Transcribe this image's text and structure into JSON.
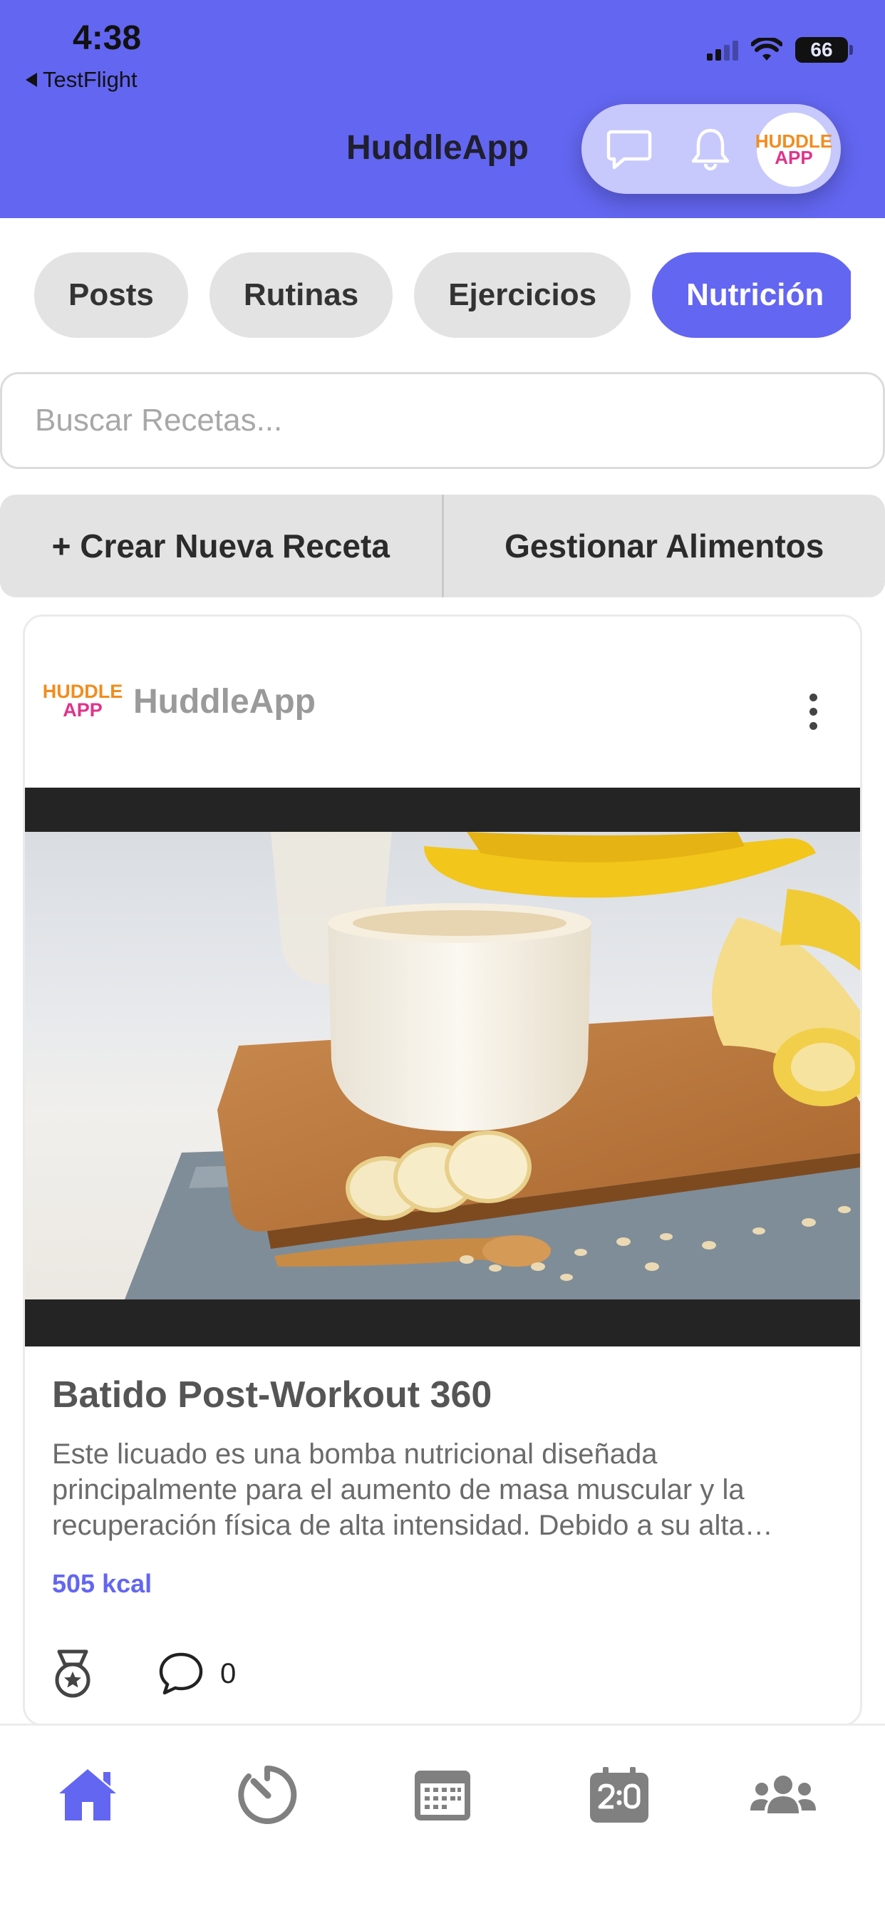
{
  "status_bar": {
    "time": "4:38",
    "back_label": "TestFlight",
    "battery": "66"
  },
  "header": {
    "title": "HuddleApp",
    "logo_top": "HUDDLE",
    "logo_bottom": "APP"
  },
  "tabs": [
    {
      "label": "Posts",
      "active": false
    },
    {
      "label": "Rutinas",
      "active": false
    },
    {
      "label": "Ejercicios",
      "active": false
    },
    {
      "label": "Nutrición",
      "active": true
    }
  ],
  "search": {
    "placeholder": "Buscar Recetas...",
    "value": ""
  },
  "actions": {
    "create_label": "+ Crear Nueva Receta",
    "manage_label": "Gestionar Alimentos"
  },
  "card": {
    "author": "HuddleApp",
    "logo_top": "HUDDLE",
    "logo_bottom": "APP",
    "title": "Batido Post-Workout 360",
    "description": "Este licuado es una bomba nutricional diseñada principalmente para el aumento de masa muscular y la recuperación física de alta intensidad. Debido a su alta…",
    "kcal": "505 kcal",
    "comments": "0"
  },
  "bottom_nav": [
    "home-icon",
    "timer-icon",
    "calendar-icon",
    "scoreboard-icon",
    "group-icon"
  ],
  "colors": {
    "accent": "#6366f1",
    "tab_inactive": "#e3e3e3",
    "header_pill": "#c7c8fb"
  }
}
